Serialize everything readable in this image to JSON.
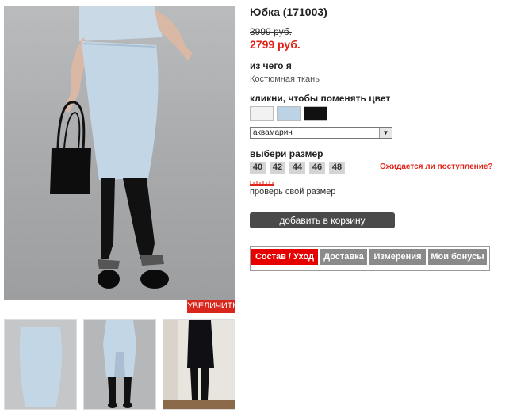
{
  "product": {
    "title": "Юбка (171003)",
    "old_price": "3999 руб.",
    "new_price": "2799 руб."
  },
  "material": {
    "label": "из чего я",
    "value": "Костюмная ткань"
  },
  "color": {
    "label": "кликни, чтобы поменять цвет",
    "swatches": [
      {
        "name": "white",
        "hex": "#f2f2f2"
      },
      {
        "name": "aquamarine",
        "hex": "#bcd3e6"
      },
      {
        "name": "black",
        "hex": "#111111"
      }
    ],
    "selected": "аквамарин"
  },
  "size": {
    "label": "выбери размер",
    "options": [
      "40",
      "42",
      "44",
      "46",
      "48"
    ],
    "waiting_link": "Ожидается ли поступление?",
    "check_link": "проверь свой размер"
  },
  "cart_button": "добавить в корзину",
  "tabs": [
    "Состав / Уход",
    "Доставка",
    "Измерения",
    "Мои бонусы"
  ],
  "zoom_button": "УВЕЛИЧИТЬ",
  "colors": {
    "accent_red": "#e2231a",
    "button_dark": "#4a4a4a",
    "tab_gray": "#8a8a8a"
  }
}
